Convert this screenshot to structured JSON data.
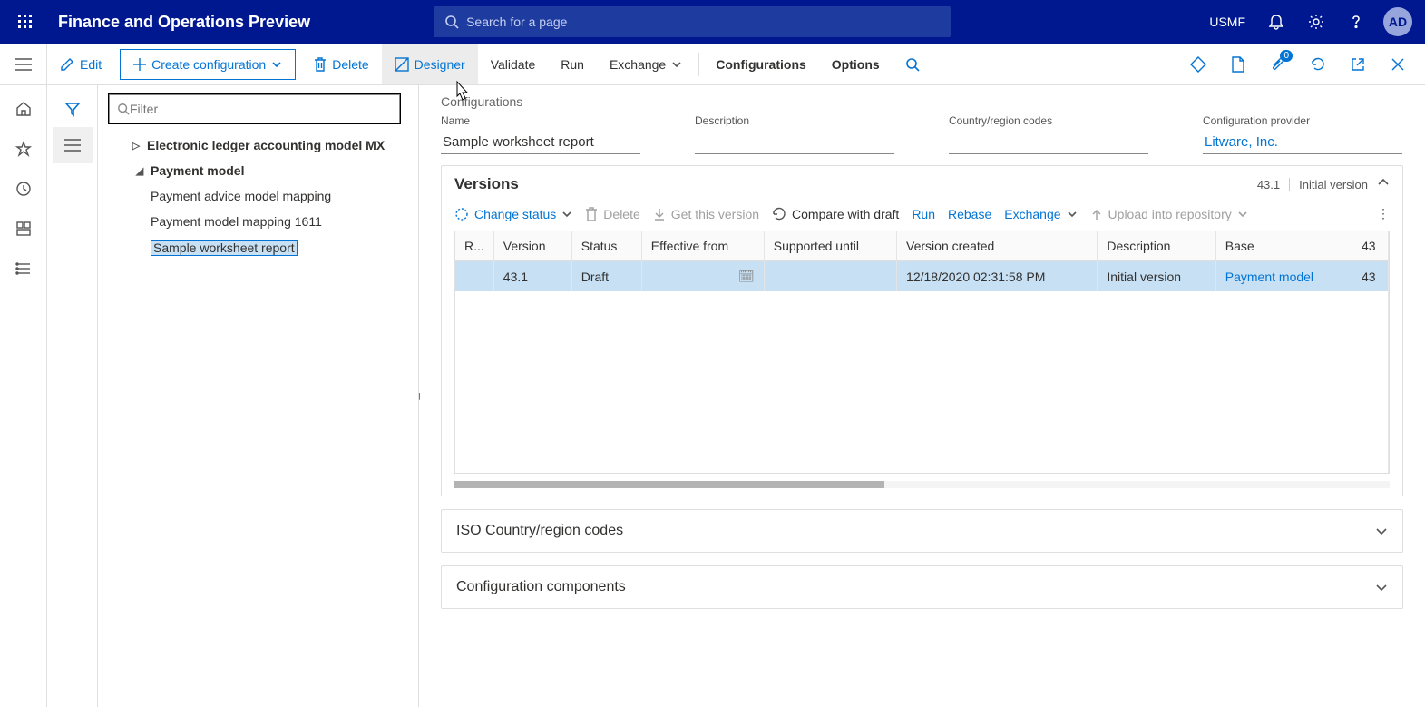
{
  "topbar": {
    "title": "Finance and Operations Preview",
    "search_placeholder": "Search for a page",
    "company": "USMF",
    "avatar": "AD"
  },
  "actions": {
    "edit": "Edit",
    "create": "Create configuration",
    "delete": "Delete",
    "designer": "Designer",
    "validate": "Validate",
    "run": "Run",
    "exchange": "Exchange",
    "configurations": "Configurations",
    "options": "Options",
    "badge_count": "0"
  },
  "tree": {
    "filter_placeholder": "Filter",
    "items": [
      {
        "label": "Electronic ledger accounting model MX",
        "level": 0,
        "caret": "▷"
      },
      {
        "label": "Payment model",
        "level": 1,
        "caret": "◢"
      },
      {
        "label": "Payment advice model mapping",
        "level": 2
      },
      {
        "label": "Payment model mapping 1611",
        "level": 2
      },
      {
        "label": "Sample worksheet report",
        "level": 2,
        "selected": true
      }
    ]
  },
  "details": {
    "breadcrumb": "Configurations",
    "fields": {
      "name_label": "Name",
      "name_value": "Sample worksheet report",
      "desc_label": "Description",
      "desc_value": "",
      "region_label": "Country/region codes",
      "region_value": "",
      "provider_label": "Configuration provider",
      "provider_value": "Litware, Inc."
    }
  },
  "versions": {
    "title": "Versions",
    "meta_version": "43.1",
    "meta_desc": "Initial version",
    "tools": {
      "change_status": "Change status",
      "delete": "Delete",
      "get": "Get this version",
      "compare": "Compare with draft",
      "run": "Run",
      "rebase": "Rebase",
      "exchange": "Exchange",
      "upload": "Upload into repository"
    },
    "columns": [
      "R...",
      "Version",
      "Status",
      "Effective from",
      "Supported until",
      "Version created",
      "Description",
      "Base",
      "43"
    ],
    "row": {
      "version": "43.1",
      "status": "Draft",
      "effective": "",
      "supported": "",
      "created": "12/18/2020 02:31:58 PM",
      "description": "Initial version",
      "base": "Payment model",
      "base_ver": "43"
    }
  },
  "panels": {
    "iso": "ISO Country/region codes",
    "components": "Configuration components"
  }
}
